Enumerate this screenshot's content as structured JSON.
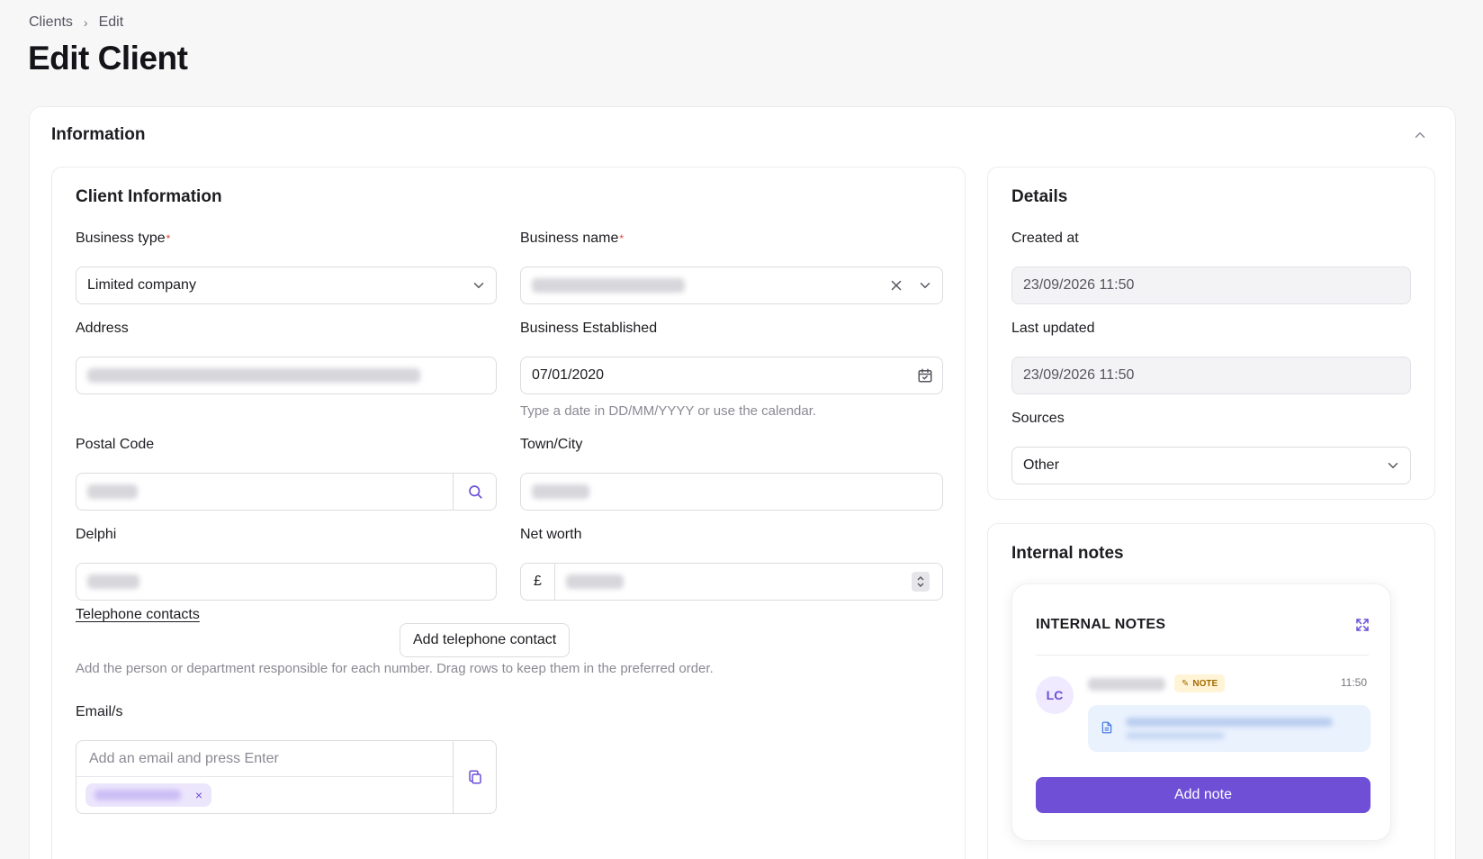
{
  "breadcrumb": {
    "root": "Clients",
    "separator": "›",
    "current": "Edit"
  },
  "page_title": "Edit Client",
  "section": {
    "title": "Information",
    "collapse_icon": "chevron-up-icon"
  },
  "client_info": {
    "title": "Client Information",
    "business_type": {
      "label": "Business type",
      "required": "*",
      "value": "Limited company"
    },
    "business_name": {
      "label": "Business name",
      "required": "*"
    },
    "address": {
      "label": "Address"
    },
    "business_established": {
      "label": "Business Established",
      "value": "07/01/2020",
      "hint": "Type a date in DD/MM/YYYY or use the calendar."
    },
    "postal_code": {
      "label": "Postal Code"
    },
    "town_city": {
      "label": "Town/City"
    },
    "delphi": {
      "label": "Delphi"
    },
    "net_worth": {
      "label": "Net worth",
      "currency": "£"
    },
    "telephone": {
      "link": "Telephone contacts",
      "add_button": "Add telephone contact",
      "hint": "Add the person or department responsible for each number. Drag rows to keep them in the preferred order."
    },
    "emails": {
      "label": "Email/s",
      "placeholder": "Add an email and press Enter",
      "chip_remove": "×"
    }
  },
  "details": {
    "title": "Details",
    "created_at": {
      "label": "Created at",
      "value": "23/09/2026 11:50"
    },
    "last_updated": {
      "label": "Last updated",
      "value": "23/09/2026 11:50"
    },
    "sources": {
      "label": "Sources",
      "value": "Other"
    }
  },
  "internal_notes": {
    "title": "Internal notes",
    "panel_title": "INTERNAL NOTES",
    "note": {
      "avatar": "LC",
      "badge": "NOTE",
      "time": "11:50"
    },
    "add_button": "Add note"
  },
  "colors": {
    "accent": "#6e4fd6",
    "required": "#e0453c",
    "note_badge_bg": "#fff4d6",
    "note_body_bg": "#eaf2fe"
  }
}
